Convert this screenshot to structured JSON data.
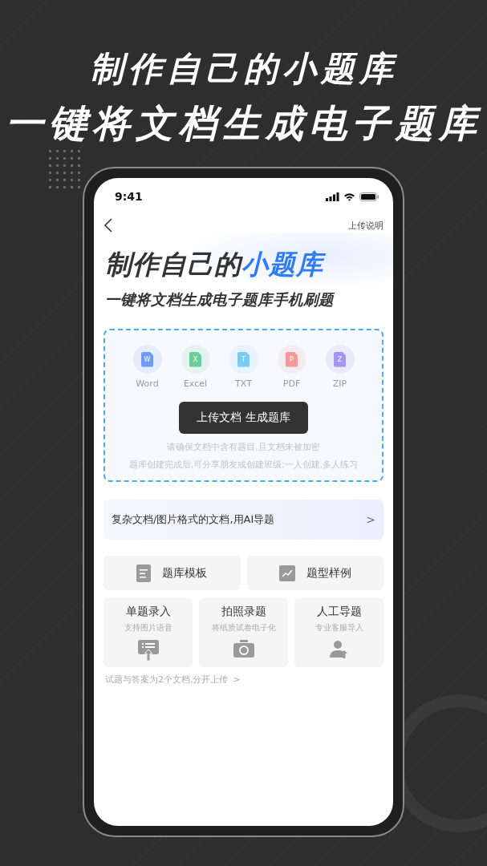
{
  "headline": [
    "制作自己的小题库",
    "一键将文档生成电子题库"
  ],
  "status_bar": {
    "time": "9:41"
  },
  "nav": {
    "action": "上传说明"
  },
  "hero": {
    "title_prefix": "制作自己的",
    "title_highlight": "小题库",
    "subtitle": "一键将文档生成电子题库手机刷题"
  },
  "upload": {
    "file_types": [
      {
        "label": "Word",
        "letter": "W",
        "color": "#6f9bf7"
      },
      {
        "label": "Excel",
        "letter": "X",
        "color": "#6ccf9a"
      },
      {
        "label": "TXT",
        "letter": "T",
        "color": "#7cc8f7"
      },
      {
        "label": "PDF",
        "letter": "P",
        "color": "#f29a9a"
      },
      {
        "label": "ZIP",
        "letter": "Z",
        "color": "#a692f0"
      }
    ],
    "button": "上传文档 生成题库",
    "hints": [
      "请确保文档中含有题目,且文档未被加密",
      "题库创建完成后,可分享朋友或创建班级;一人创建,多人练习"
    ]
  },
  "ai_import": {
    "label": "复杂文档/图片格式的文档,用AI导题",
    "arrow": ">"
  },
  "shortcuts": [
    {
      "label": "题库模板",
      "kind": "document"
    },
    {
      "label": "题型样例",
      "kind": "chart"
    }
  ],
  "methods": [
    {
      "title": "单题录入",
      "desc": "支持图片语音",
      "kind": "upload"
    },
    {
      "title": "拍照录题",
      "desc": "将纸质试卷电子化",
      "kind": "camera"
    },
    {
      "title": "人工导题",
      "desc": "专业客服导入",
      "kind": "person"
    }
  ],
  "footer": {
    "text": "试题与答案为2个文档,分开上传",
    "arrow": ">"
  }
}
